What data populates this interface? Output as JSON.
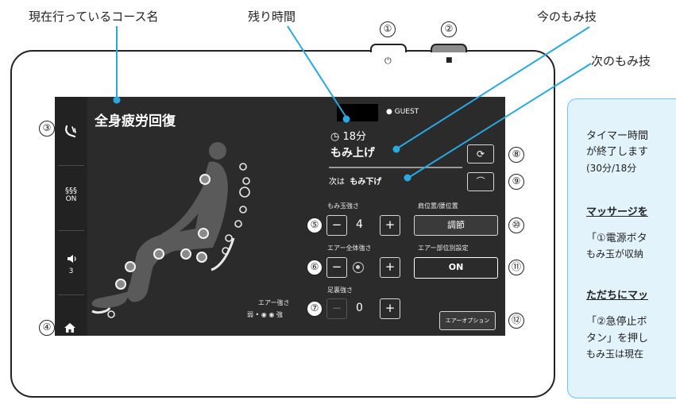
{
  "callouts": {
    "course_name": "現在行っているコース名",
    "remaining_time": "残り時間",
    "current_technique": "今のもみ技",
    "next_technique": "次のもみ技"
  },
  "numbers": [
    "①",
    "②",
    "③",
    "④",
    "⑤",
    "⑥",
    "⑦",
    "⑧",
    "⑨",
    "⑩",
    "⑪",
    "⑫"
  ],
  "device_buttons": {
    "power_symbol": "⏻",
    "stop_symbol": "■"
  },
  "sidebar": {
    "heat_label": "ON",
    "volume_level": "3"
  },
  "screen": {
    "course_title": "全身疲労回復",
    "user_label": "GUEST",
    "timer": "18分",
    "current_technique": "もみ上げ",
    "next_prefix": "次は",
    "next_technique": "もみ下げ",
    "ball_strength": {
      "label": "もみ玉強さ",
      "value": "4"
    },
    "position": {
      "label": "肩位置/腰位置",
      "button": "調節"
    },
    "air_total": {
      "label": "エアー全体強さ"
    },
    "air_part": {
      "label": "エアー部位別設定",
      "button": "ON"
    },
    "foot": {
      "label": "足裏強さ",
      "value": "0"
    },
    "air_legend": {
      "title": "エアー強さ",
      "weak": "弱",
      "strong": "強"
    },
    "air_option": "エアーオプション",
    "minus": "−",
    "plus": "+"
  },
  "panel": {
    "line1": "タイマー時間",
    "line2": "が終了します",
    "line3": "(30分/18分",
    "heading1": "マッサージを",
    "line4": "「①電源ボタ",
    "line5": "もみ玉が収納",
    "heading2": "ただちにマッ",
    "line6": "「②急停止ボ",
    "line7": "タン」を押し",
    "line8": "もみ玉は現在"
  },
  "colors": {
    "accent": "#29a9e1",
    "screen_bg": "#2b2b2b",
    "panel_bg": "#e3f3fb"
  }
}
